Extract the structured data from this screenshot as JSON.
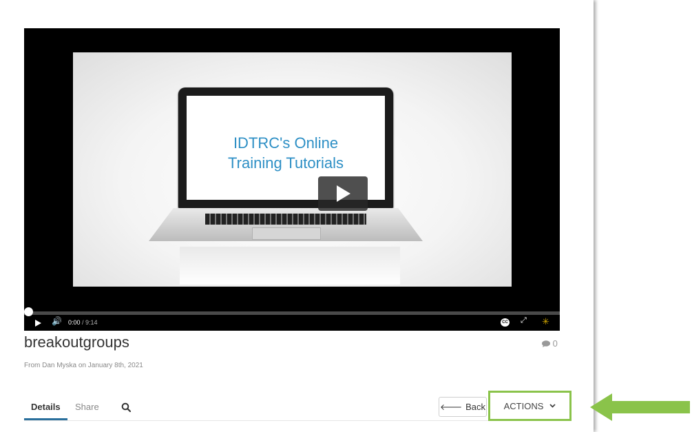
{
  "video": {
    "slide_line1": "IDTRC's Online",
    "slide_line2": "Training Tutorials",
    "current_time": "0:00",
    "duration": "/ 9:14",
    "progress": 0,
    "cc_label": "CC"
  },
  "entry": {
    "title": "breakoutgroups",
    "comment_count": "0",
    "meta": "From Dan Myska on January 8th, 2021"
  },
  "tabs": [
    {
      "label": "Details",
      "active": true
    },
    {
      "label": "Share",
      "active": false
    }
  ],
  "buttons": {
    "back_label": "Back",
    "actions_label": "ACTIONS"
  },
  "colors": {
    "highlight_green": "#8ac34a",
    "active_tab_underline": "#2a6f9c",
    "slide_text": "#2d8fc5"
  },
  "icons": [
    "play-icon",
    "volume-icon",
    "closed-captions-icon",
    "fullscreen-icon",
    "kaltura-logo-icon",
    "comment-icon",
    "search-icon",
    "back-arrow-icon",
    "chevron-down-icon",
    "pointer-arrow-icon"
  ]
}
